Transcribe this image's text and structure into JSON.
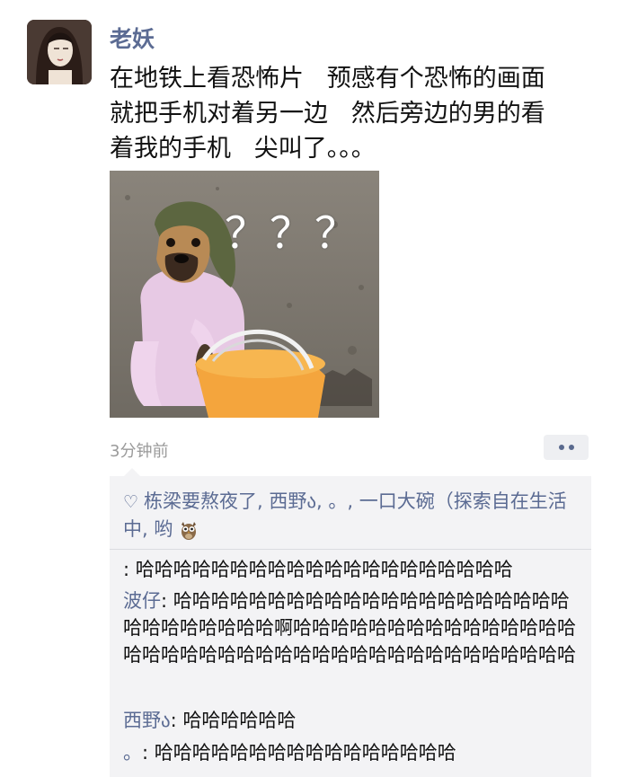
{
  "post": {
    "author": "老妖",
    "text_lines": [
      "在地铁上看恐怖片   预感有个恐怖的画面",
      "就把手机对着另一边   然后旁边的男的看",
      "着我的手机   尖叫了。。。"
    ],
    "image_marks": "？？？",
    "time": "3分钟前"
  },
  "likes": {
    "icon": "heart-outline-icon",
    "text": "栋梁要熬夜了, 西野ა, 。, 一口大碗（探索自在生活中, 哟"
  },
  "comments": [
    {
      "name": "",
      "sep": ": ",
      "text": "哈哈哈哈哈哈哈哈哈哈哈哈哈哈哈哈哈哈哈哈"
    },
    {
      "name": "波仔",
      "sep": ": ",
      "text": "哈哈哈哈哈哈哈哈哈哈哈哈哈哈哈哈哈哈哈哈哈哈哈哈哈哈哈哈哈啊哈哈哈哈哈哈哈哈哈哈哈哈哈哈哈哈哈哈哈哈哈哈哈哈哈哈哈哈哈哈哈哈哈哈哈哈哈哈哈"
    },
    {
      "name": "西野ა",
      "sep": ": ",
      "text": "哈哈哈哈哈哈"
    },
    {
      "name": "。",
      "sep": ": ",
      "text": "哈哈哈哈哈哈哈哈哈哈哈哈哈哈哈哈"
    }
  ],
  "colors": {
    "link": "#5b6b93",
    "comment_bg": "#f3f3f5",
    "time": "#9a9a9a"
  }
}
